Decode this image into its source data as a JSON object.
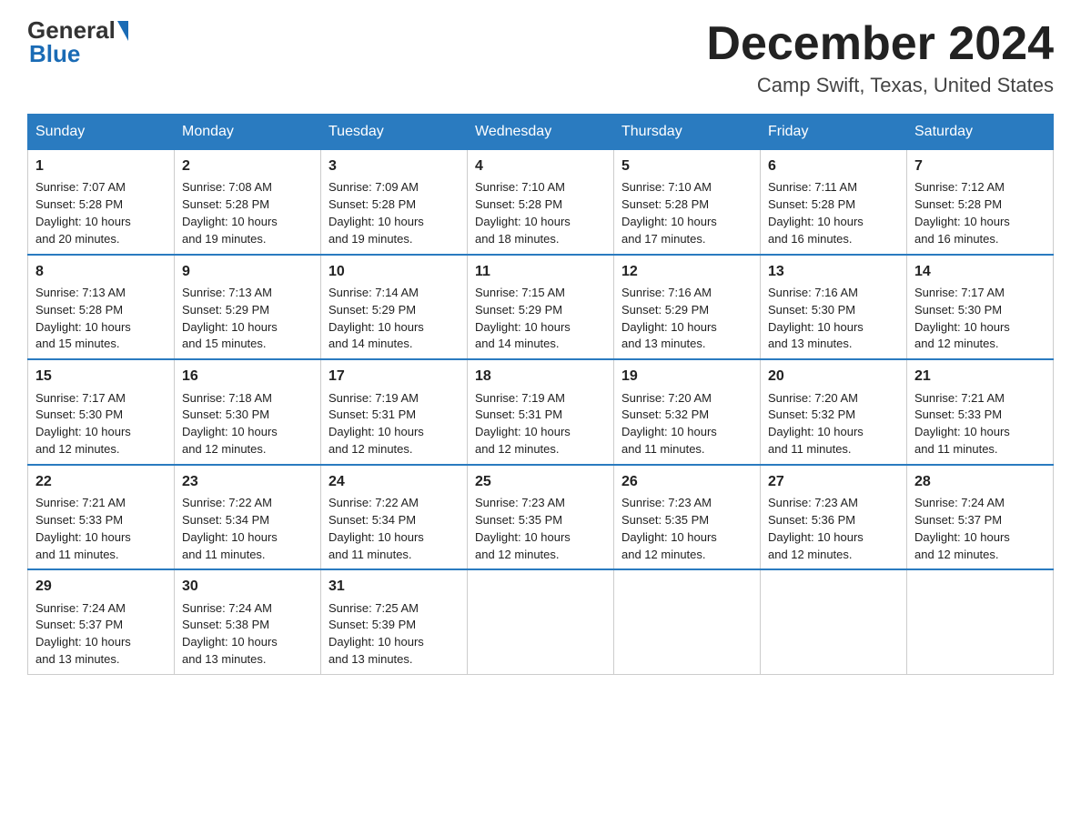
{
  "header": {
    "logo_general": "General",
    "logo_blue": "Blue",
    "month_year": "December 2024",
    "location": "Camp Swift, Texas, United States"
  },
  "days_of_week": [
    "Sunday",
    "Monday",
    "Tuesday",
    "Wednesday",
    "Thursday",
    "Friday",
    "Saturday"
  ],
  "weeks": [
    [
      {
        "day": "1",
        "sunrise": "7:07 AM",
        "sunset": "5:28 PM",
        "daylight": "10 hours and 20 minutes."
      },
      {
        "day": "2",
        "sunrise": "7:08 AM",
        "sunset": "5:28 PM",
        "daylight": "10 hours and 19 minutes."
      },
      {
        "day": "3",
        "sunrise": "7:09 AM",
        "sunset": "5:28 PM",
        "daylight": "10 hours and 19 minutes."
      },
      {
        "day": "4",
        "sunrise": "7:10 AM",
        "sunset": "5:28 PM",
        "daylight": "10 hours and 18 minutes."
      },
      {
        "day": "5",
        "sunrise": "7:10 AM",
        "sunset": "5:28 PM",
        "daylight": "10 hours and 17 minutes."
      },
      {
        "day": "6",
        "sunrise": "7:11 AM",
        "sunset": "5:28 PM",
        "daylight": "10 hours and 16 minutes."
      },
      {
        "day": "7",
        "sunrise": "7:12 AM",
        "sunset": "5:28 PM",
        "daylight": "10 hours and 16 minutes."
      }
    ],
    [
      {
        "day": "8",
        "sunrise": "7:13 AM",
        "sunset": "5:28 PM",
        "daylight": "10 hours and 15 minutes."
      },
      {
        "day": "9",
        "sunrise": "7:13 AM",
        "sunset": "5:29 PM",
        "daylight": "10 hours and 15 minutes."
      },
      {
        "day": "10",
        "sunrise": "7:14 AM",
        "sunset": "5:29 PM",
        "daylight": "10 hours and 14 minutes."
      },
      {
        "day": "11",
        "sunrise": "7:15 AM",
        "sunset": "5:29 PM",
        "daylight": "10 hours and 14 minutes."
      },
      {
        "day": "12",
        "sunrise": "7:16 AM",
        "sunset": "5:29 PM",
        "daylight": "10 hours and 13 minutes."
      },
      {
        "day": "13",
        "sunrise": "7:16 AM",
        "sunset": "5:30 PM",
        "daylight": "10 hours and 13 minutes."
      },
      {
        "day": "14",
        "sunrise": "7:17 AM",
        "sunset": "5:30 PM",
        "daylight": "10 hours and 12 minutes."
      }
    ],
    [
      {
        "day": "15",
        "sunrise": "7:17 AM",
        "sunset": "5:30 PM",
        "daylight": "10 hours and 12 minutes."
      },
      {
        "day": "16",
        "sunrise": "7:18 AM",
        "sunset": "5:30 PM",
        "daylight": "10 hours and 12 minutes."
      },
      {
        "day": "17",
        "sunrise": "7:19 AM",
        "sunset": "5:31 PM",
        "daylight": "10 hours and 12 minutes."
      },
      {
        "day": "18",
        "sunrise": "7:19 AM",
        "sunset": "5:31 PM",
        "daylight": "10 hours and 12 minutes."
      },
      {
        "day": "19",
        "sunrise": "7:20 AM",
        "sunset": "5:32 PM",
        "daylight": "10 hours and 11 minutes."
      },
      {
        "day": "20",
        "sunrise": "7:20 AM",
        "sunset": "5:32 PM",
        "daylight": "10 hours and 11 minutes."
      },
      {
        "day": "21",
        "sunrise": "7:21 AM",
        "sunset": "5:33 PM",
        "daylight": "10 hours and 11 minutes."
      }
    ],
    [
      {
        "day": "22",
        "sunrise": "7:21 AM",
        "sunset": "5:33 PM",
        "daylight": "10 hours and 11 minutes."
      },
      {
        "day": "23",
        "sunrise": "7:22 AM",
        "sunset": "5:34 PM",
        "daylight": "10 hours and 11 minutes."
      },
      {
        "day": "24",
        "sunrise": "7:22 AM",
        "sunset": "5:34 PM",
        "daylight": "10 hours and 11 minutes."
      },
      {
        "day": "25",
        "sunrise": "7:23 AM",
        "sunset": "5:35 PM",
        "daylight": "10 hours and 12 minutes."
      },
      {
        "day": "26",
        "sunrise": "7:23 AM",
        "sunset": "5:35 PM",
        "daylight": "10 hours and 12 minutes."
      },
      {
        "day": "27",
        "sunrise": "7:23 AM",
        "sunset": "5:36 PM",
        "daylight": "10 hours and 12 minutes."
      },
      {
        "day": "28",
        "sunrise": "7:24 AM",
        "sunset": "5:37 PM",
        "daylight": "10 hours and 12 minutes."
      }
    ],
    [
      {
        "day": "29",
        "sunrise": "7:24 AM",
        "sunset": "5:37 PM",
        "daylight": "10 hours and 13 minutes."
      },
      {
        "day": "30",
        "sunrise": "7:24 AM",
        "sunset": "5:38 PM",
        "daylight": "10 hours and 13 minutes."
      },
      {
        "day": "31",
        "sunrise": "7:25 AM",
        "sunset": "5:39 PM",
        "daylight": "10 hours and 13 minutes."
      },
      null,
      null,
      null,
      null
    ]
  ],
  "labels": {
    "sunrise": "Sunrise:",
    "sunset": "Sunset:",
    "daylight": "Daylight:"
  }
}
